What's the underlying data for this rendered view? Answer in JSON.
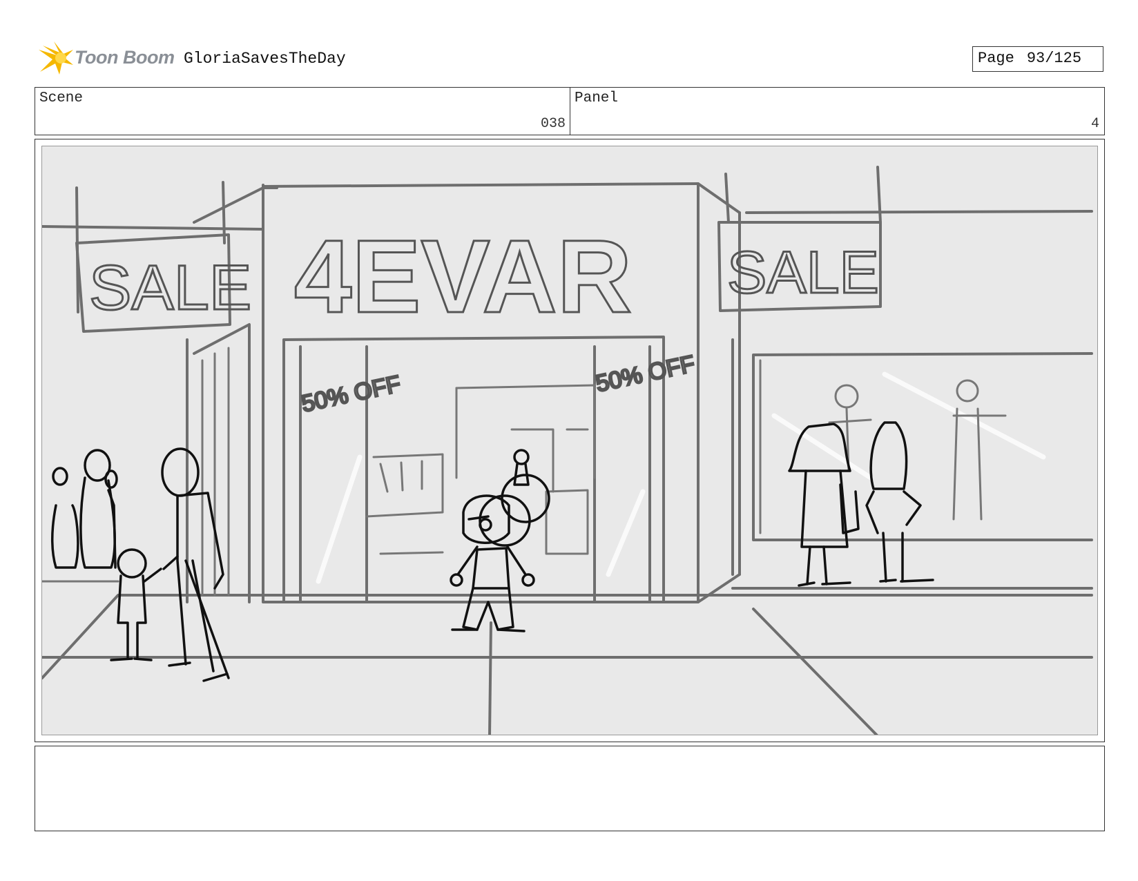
{
  "header": {
    "brand": "Toon Boom",
    "project_title": "GloriaSavesTheDay",
    "page_label": "Page",
    "page_value": "93/125"
  },
  "info": {
    "scene_label": "Scene",
    "scene_value": "038",
    "panel_label": "Panel",
    "panel_value": "4"
  },
  "artwork": {
    "store_sign": "4EVAR",
    "left_sign": "SALE",
    "right_sign": "SALE",
    "window_left_sticker": "50% OFF",
    "window_right_sticker": "50% OFF"
  },
  "notes": {
    "text": ""
  },
  "colors": {
    "logo_accent": "#f5b800",
    "logo_text": "#8a8f96",
    "drawing_bg": "#e9e9e9"
  }
}
